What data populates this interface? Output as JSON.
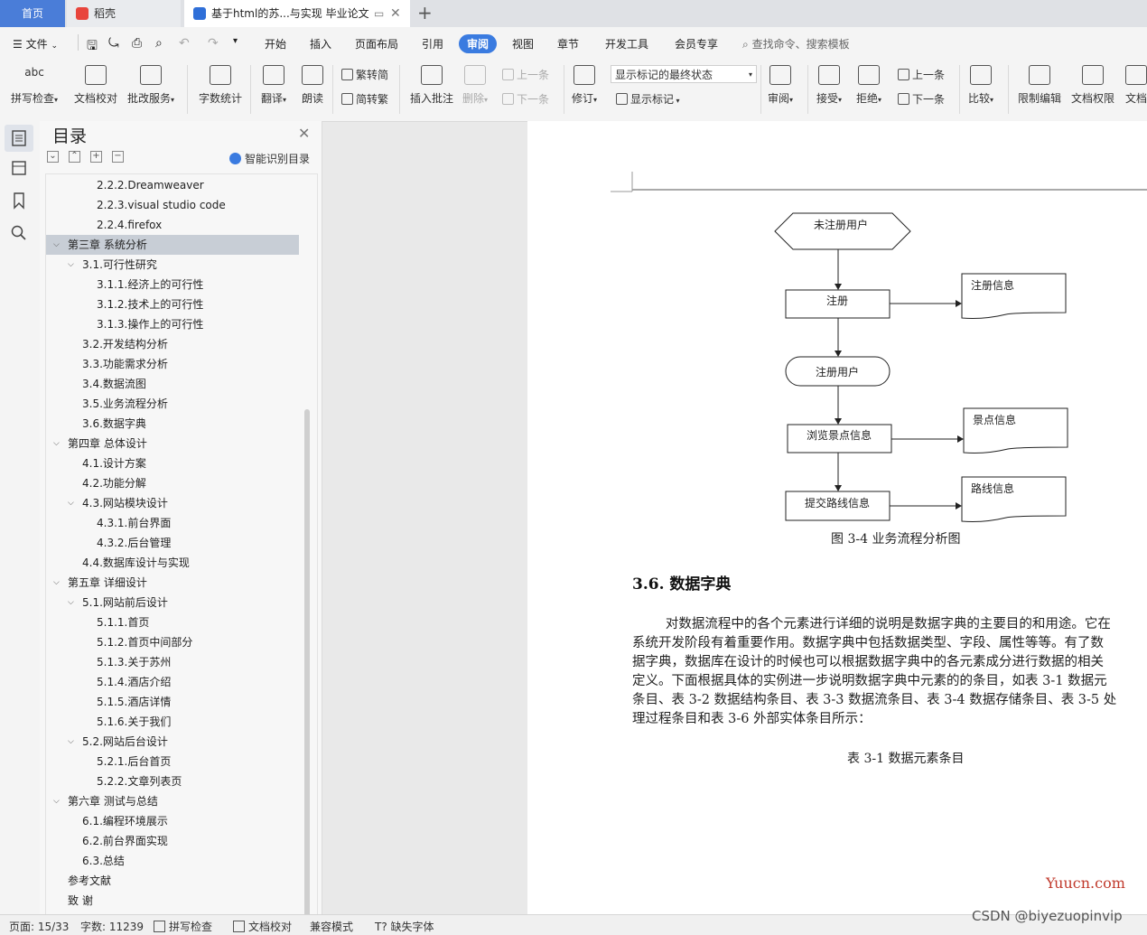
{
  "tabs": {
    "home": "首页",
    "daoke": "稻壳",
    "doc": "基于html的苏...与实现 毕业论文"
  },
  "menu": {
    "file": "文件",
    "items": [
      "开始",
      "插入",
      "页面布局",
      "引用",
      "审阅",
      "视图",
      "章节",
      "开发工具",
      "会员专享"
    ],
    "search_placeholder": "查找命令、搜索模板"
  },
  "ribbon": {
    "spell_check": "拼写检查",
    "doc_proof": "文档校对",
    "revise_service": "批改服务",
    "word_count": "字数统计",
    "translate": "翻译",
    "read_aloud": "朗读",
    "trad_to_simp": "繁转简",
    "simp_to_trad": "简转繁",
    "insert_comment": "插入批注",
    "delete": "删除",
    "prev_comment": "上一条",
    "next_comment": "下一条",
    "track_changes": "修订",
    "markup_state": "显示标记的最终状态",
    "show_markup": "显示标记",
    "review_pane": "审阅",
    "accept": "接受",
    "reject": "拒绝",
    "prev_change": "上一条",
    "next_change": "下一条",
    "compare": "比较",
    "restrict_edit": "限制编辑",
    "doc_permission": "文档权限",
    "doc_more": "文档"
  },
  "toc": {
    "title": "目录",
    "smart": "智能识别目录",
    "items": [
      {
        "text": "2.2.2.Dreamweaver",
        "level": 3,
        "caret": ""
      },
      {
        "text": "2.2.3.visual studio code",
        "level": 3,
        "caret": ""
      },
      {
        "text": "2.2.4.firefox",
        "level": 3,
        "caret": ""
      },
      {
        "text": "第三章  系统分析",
        "level": 1,
        "caret": "open",
        "selected": true
      },
      {
        "text": "3.1.可行性研究",
        "level": 2,
        "caret": "open"
      },
      {
        "text": "3.1.1.经济上的可行性",
        "level": 3,
        "caret": ""
      },
      {
        "text": "3.1.2.技术上的可行性",
        "level": 3,
        "caret": ""
      },
      {
        "text": "3.1.3.操作上的可行性",
        "level": 3,
        "caret": ""
      },
      {
        "text": "3.2.开发结构分析",
        "level": 2,
        "caret": ""
      },
      {
        "text": "3.3.功能需求分析",
        "level": 2,
        "caret": ""
      },
      {
        "text": "3.4.数据流图",
        "level": 2,
        "caret": ""
      },
      {
        "text": "3.5.业务流程分析",
        "level": 2,
        "caret": ""
      },
      {
        "text": "3.6.数据字典",
        "level": 2,
        "caret": ""
      },
      {
        "text": "第四章  总体设计",
        "level": 1,
        "caret": "open"
      },
      {
        "text": "4.1.设计方案",
        "level": 2,
        "caret": ""
      },
      {
        "text": "4.2.功能分解",
        "level": 2,
        "caret": ""
      },
      {
        "text": "4.3.网站模块设计",
        "level": 2,
        "caret": "open"
      },
      {
        "text": "4.3.1.前台界面",
        "level": 3,
        "caret": ""
      },
      {
        "text": "4.3.2.后台管理",
        "level": 3,
        "caret": ""
      },
      {
        "text": "4.4.数据库设计与实现",
        "level": 2,
        "caret": ""
      },
      {
        "text": "第五章  详细设计",
        "level": 1,
        "caret": "open"
      },
      {
        "text": "5.1.网站前后设计",
        "level": 2,
        "caret": "open"
      },
      {
        "text": "5.1.1.首页",
        "level": 3,
        "caret": ""
      },
      {
        "text": "5.1.2.首页中间部分",
        "level": 3,
        "caret": ""
      },
      {
        "text": "5.1.3.关于苏州",
        "level": 3,
        "caret": ""
      },
      {
        "text": "5.1.4.酒店介绍",
        "level": 3,
        "caret": ""
      },
      {
        "text": "5.1.5.酒店详情",
        "level": 3,
        "caret": ""
      },
      {
        "text": "5.1.6.关于我们",
        "level": 3,
        "caret": ""
      },
      {
        "text": "5.2.网站后台设计",
        "level": 2,
        "caret": "open"
      },
      {
        "text": "5.2.1.后台首页",
        "level": 3,
        "caret": ""
      },
      {
        "text": "5.2.2.文章列表页",
        "level": 3,
        "caret": ""
      },
      {
        "text": "第六章  测试与总结",
        "level": 1,
        "caret": "open"
      },
      {
        "text": "6.1.编程环境展示",
        "level": 2,
        "caret": ""
      },
      {
        "text": "6.2.前台界面实现",
        "level": 2,
        "caret": ""
      },
      {
        "text": "6.3.总结",
        "level": 2,
        "caret": ""
      },
      {
        "text": "参考文献",
        "level": 1,
        "caret": ""
      },
      {
        "text": "致    谢",
        "level": 1,
        "caret": ""
      }
    ]
  },
  "flowchart": {
    "start": "未注册用户",
    "register": "注册",
    "register_info": "注册信息",
    "registered_user": "注册用户",
    "browse": "浏览景点信息",
    "scenic_info": "景点信息",
    "submit": "提交路线信息",
    "route_info": "路线信息"
  },
  "document": {
    "figure_caption": "图 3-4  业务流程分析图",
    "section_heading": "3.6.  数据字典",
    "body_lines": [
      "        对数据流程中的各个元素进行详细的说明是数据字典的主要目的和用途。它在",
      "系统开发阶段有着重要作用。数据字典中包括数据类型、字段、属性等等。有了数",
      "据字典，数据库在设计的时候也可以根据数据字典中的各元素成分进行数据的相关",
      "定义。下面根据具体的实例进一步说明数据字典中元素的的条目，如表 3-1 数据元",
      "条目、表 3-2 数据结构条目、表 3-3 数据流条目、表 3-4  数据存储条目、表 3-5  处",
      "理过程条目和表 3-6  外部实体条目所示："
    ],
    "table_caption": "表 3-1  数据元素条目",
    "watermark": "Yuucn.com"
  },
  "status": {
    "page": "页面: 15/33",
    "words": "字数: 11239",
    "spell": "拼写检查",
    "proof": "文档校对",
    "compat": "兼容模式",
    "missing_font": "缺失字体",
    "credit": "CSDN @biyezuopinvip"
  },
  "colors": {
    "accent": "#3a7be0"
  }
}
